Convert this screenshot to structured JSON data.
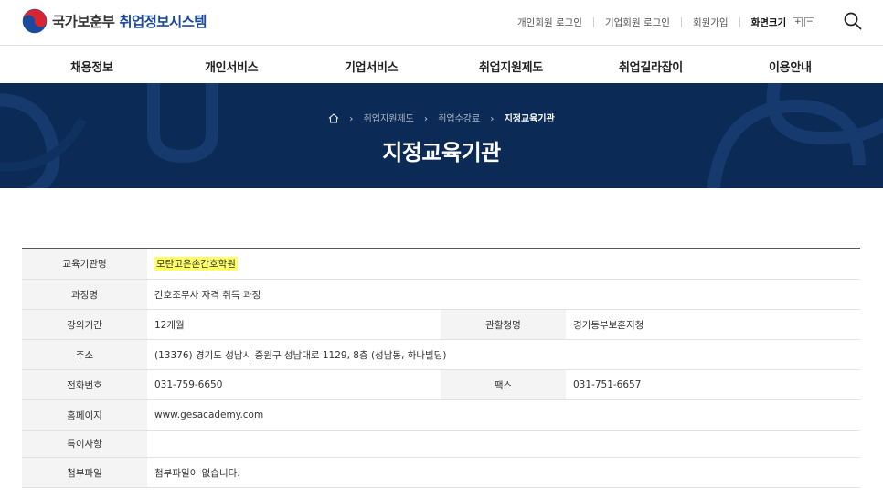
{
  "header": {
    "org": "국가보훈부",
    "system": "취업정보시스템",
    "util_links": [
      "개인회원 로그인",
      "기업회원 로그인",
      "회원가입"
    ],
    "font_size_label": "화면크기",
    "font_plus": "+",
    "font_minus": "−"
  },
  "nav": [
    "채용정보",
    "개인서비스",
    "기업서비스",
    "취업지원제도",
    "취업길라잡이",
    "이용안내"
  ],
  "banner": {
    "breadcrumb": [
      "취업지원제도",
      "취업수강료",
      "지정교육기관"
    ],
    "title": "지정교육기관",
    "bg_color": "#0b2a55"
  },
  "info": {
    "rows": [
      {
        "label": "교육기관명",
        "value": "모란고은손간호학원"
      },
      {
        "label": "과정명",
        "value": "간호조무사 자격 취득 과정"
      },
      {
        "label": "강의기간",
        "value": "12개월",
        "label2": "관할청명",
        "value2": "경기동부보훈지청"
      },
      {
        "label": "주소",
        "value": "(13376) 경기도 성남시 중원구 성남대로 1129, 8층 (성남동, 하나빌딩)"
      },
      {
        "label": "전화번호",
        "value": "031-759-6650",
        "label2": "팩스",
        "value2": "031-751-6657"
      },
      {
        "label": "홈페이지",
        "value": "www.gesacademy.com"
      },
      {
        "label": "특이사항",
        "value": ""
      },
      {
        "label": "첨부파일",
        "value": "첨부파일이 없습니다."
      }
    ]
  },
  "colors": {
    "brand_blue": "#1b4a9c",
    "banner": "#0b2a55",
    "highlight": "#ffff66"
  },
  "icons": [
    "taegeuk-logo-icon",
    "search-icon",
    "home-icon",
    "chevron-right-icon"
  ]
}
